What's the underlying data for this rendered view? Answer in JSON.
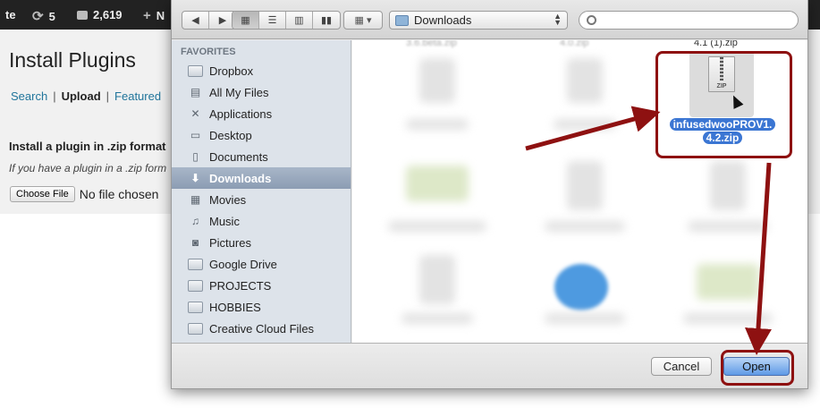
{
  "wp": {
    "adminbar": {
      "site_fragment": "te",
      "updates_count": "5",
      "comments_count": "2,619",
      "new_fragment": "N"
    },
    "page_title": "Install Plugins",
    "links": [
      {
        "label": "Search"
      },
      {
        "label": "Upload",
        "current": true
      },
      {
        "label": "Featured"
      }
    ],
    "separator": "|",
    "heading": "Install a plugin in .zip format",
    "help_text": "If you have a plugin in a .zip form",
    "file_input": {
      "button_label": "Choose File",
      "status_text": "No file chosen"
    }
  },
  "dialog": {
    "toolbar": {
      "back_icon": "chevron-left-icon",
      "forward_icon": "chevron-right-icon",
      "view_modes": [
        "icon-view-icon",
        "list-view-icon",
        "column-view-icon",
        "coverflow-view-icon"
      ],
      "arrange_icon": "arrange-grid-icon",
      "location": "Downloads",
      "search_placeholder": ""
    },
    "sidebar": {
      "section": "FAVORITES",
      "items": [
        {
          "label": "Dropbox",
          "icon": "folder-icon"
        },
        {
          "label": "All My Files",
          "icon": "all-files-icon"
        },
        {
          "label": "Applications",
          "icon": "applications-icon"
        },
        {
          "label": "Desktop",
          "icon": "desktop-icon"
        },
        {
          "label": "Documents",
          "icon": "documents-icon"
        },
        {
          "label": "Downloads",
          "icon": "downloads-icon",
          "selected": true
        },
        {
          "label": "Movies",
          "icon": "movies-icon"
        },
        {
          "label": "Music",
          "icon": "music-icon"
        },
        {
          "label": "Pictures",
          "icon": "pictures-icon"
        },
        {
          "label": "Google Drive",
          "icon": "folder-icon"
        },
        {
          "label": "PROJECTS",
          "icon": "folder-icon"
        },
        {
          "label": "HOBBIES",
          "icon": "folder-icon"
        },
        {
          "label": "Creative Cloud Files",
          "icon": "folder-icon"
        }
      ]
    },
    "files": {
      "top_row_labels": [
        "3.6.beta.zip",
        "4.0.zip",
        "4.1 (1).zip"
      ],
      "selected_file": {
        "line1": "infusedwooPROV1.",
        "line2": "4.2.zip",
        "type_label": "ZIP"
      }
    },
    "buttons": {
      "cancel": "Cancel",
      "open": "Open"
    }
  },
  "annotation_color": "#8e1111"
}
